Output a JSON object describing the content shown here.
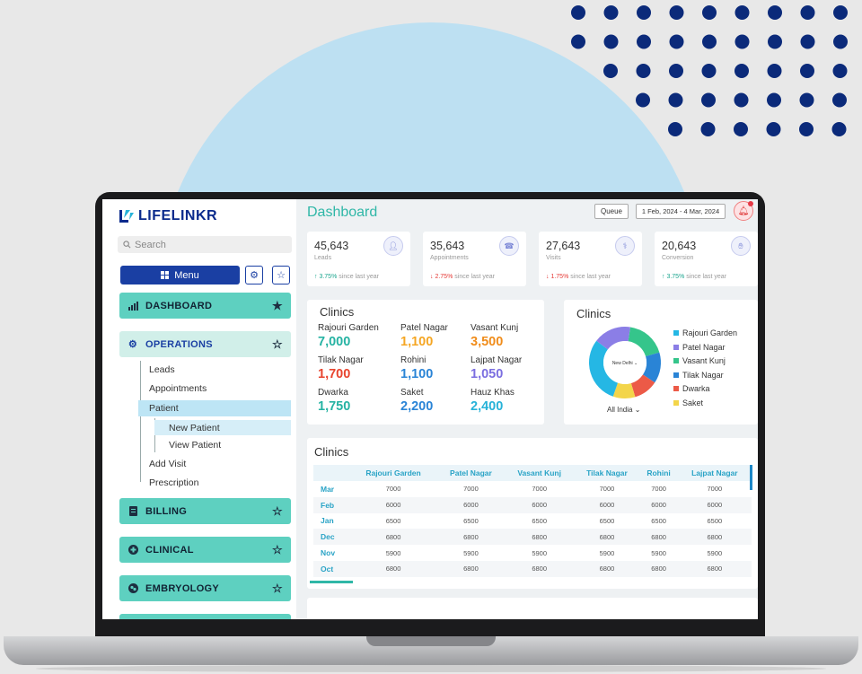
{
  "app": {
    "logo_text": "LIFELINKR",
    "page_title": "Dashboard"
  },
  "header": {
    "queue_label": "Queue",
    "date_range": "1 Feb, 2024 - 4 Mar, 2024"
  },
  "sidebar": {
    "search_placeholder": "Search",
    "menu_label": "Menu",
    "nav": [
      {
        "label": "DASHBOARD"
      },
      {
        "label": "OPERATIONS"
      },
      {
        "label": "BILLING"
      },
      {
        "label": "CLINICAL"
      },
      {
        "label": "EMBRYOLOGY"
      }
    ],
    "operations_items": [
      "Leads",
      "Appointments",
      "Patient",
      "New Patient",
      "View Patient",
      "Add Visit",
      "Prescription"
    ]
  },
  "stats": [
    {
      "value": "45,643",
      "label": "Leads",
      "change": "3.75%",
      "direction": "up",
      "suffix": "since last year"
    },
    {
      "value": "35,643",
      "label": "Appointments",
      "change": "2.75%",
      "direction": "down",
      "suffix": "since last year"
    },
    {
      "value": "27,643",
      "label": "Visits",
      "change": "1.75%",
      "direction": "down",
      "suffix": "since last year"
    },
    {
      "value": "20,643",
      "label": "Conversion",
      "change": "3.75%",
      "direction": "up",
      "suffix": "since last year"
    }
  ],
  "clinics_card": {
    "title": "Clinics",
    "items": [
      {
        "name": "Rajouri Garden",
        "value": "7,000",
        "color": "#26b3a3"
      },
      {
        "name": "Patel Nagar",
        "value": "1,100",
        "color": "#f5a623"
      },
      {
        "name": "Vasant Kunj",
        "value": "3,500",
        "color": "#f08c1a"
      },
      {
        "name": "Tilak Nagar",
        "value": "1,700",
        "color": "#e8442e"
      },
      {
        "name": "Rohini",
        "value": "1,100",
        "color": "#2a84d6"
      },
      {
        "name": "Lajpat Nagar",
        "value": "1,050",
        "color": "#7b6ee0"
      },
      {
        "name": "Dwarka",
        "value": "1,750",
        "color": "#26b3a3"
      },
      {
        "name": "Saket",
        "value": "2,200",
        "color": "#2a84d6"
      },
      {
        "name": "Hauz Khas",
        "value": "2,400",
        "color": "#27b2d8"
      }
    ]
  },
  "clinics_donut": {
    "title": "Clinics",
    "center_label": "New Delhi",
    "filter_label": "All India",
    "legend": [
      {
        "name": "Rajouri Garden",
        "color": "#25b7e4"
      },
      {
        "name": "Patel Nagar",
        "color": "#8b7ee6"
      },
      {
        "name": "Vasant Kunj",
        "color": "#35c58b"
      },
      {
        "name": "Tilak Nagar",
        "color": "#2a84d6"
      },
      {
        "name": "Dwarka",
        "color": "#ec5a47"
      },
      {
        "name": "Saket",
        "color": "#f3d54a"
      }
    ],
    "slices": [
      {
        "name": "Vasant Kunj",
        "value": 18,
        "color": "#35c58b"
      },
      {
        "name": "Tilak Nagar",
        "value": 14,
        "color": "#2a84d6"
      },
      {
        "name": "Dwarka",
        "value": 11,
        "color": "#ec5a47"
      },
      {
        "name": "Saket",
        "value": 10,
        "color": "#f3d54a"
      },
      {
        "name": "Rajouri Garden",
        "value": 30,
        "color": "#25b7e4"
      },
      {
        "name": "Patel Nagar",
        "value": 17,
        "color": "#8b7ee6"
      }
    ]
  },
  "clinics_table": {
    "title": "Clinics",
    "columns": [
      "",
      "Rajouri Garden",
      "Patel Nagar",
      "Vasant Kunj",
      "Tilak Nagar",
      "Rohini",
      "Lajpat Nagar"
    ],
    "rows": [
      [
        "Mar",
        "7000",
        "7000",
        "7000",
        "7000",
        "7000",
        "7000"
      ],
      [
        "Feb",
        "6000",
        "6000",
        "6000",
        "6000",
        "6000",
        "6000"
      ],
      [
        "Jan",
        "6500",
        "6500",
        "6500",
        "6500",
        "6500",
        "6500"
      ],
      [
        "Dec",
        "6800",
        "6800",
        "6800",
        "6800",
        "6800",
        "6800"
      ],
      [
        "Nov",
        "5900",
        "5900",
        "5900",
        "5900",
        "5900",
        "5900"
      ],
      [
        "Oct",
        "6800",
        "6800",
        "6800",
        "6800",
        "6800",
        "6800"
      ]
    ]
  }
}
